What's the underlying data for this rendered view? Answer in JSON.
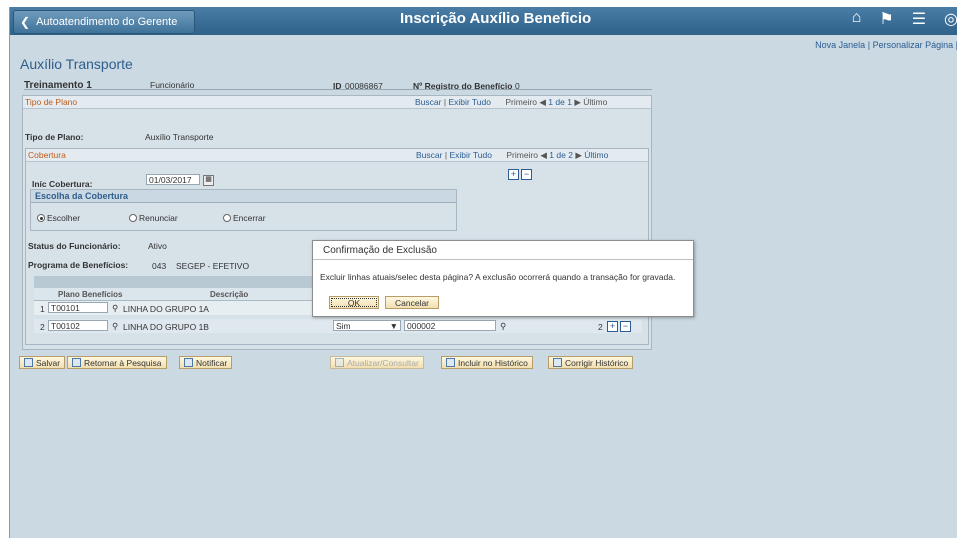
{
  "header": {
    "back_label": "Autoatendimento do Gerente",
    "title": "Inscrição Auxílio Beneficio",
    "icons": [
      "home-icon",
      "flag-icon",
      "menu-icon",
      "compass-icon"
    ]
  },
  "links": {
    "new_window": "Nova Janela",
    "personalize": "Personalizar Página",
    "sep": "|"
  },
  "page_title": "Auxílio Transporte",
  "employee": {
    "name": "Treinamento 1",
    "role": "Funcionário",
    "id_label": "ID",
    "id_value": "00086867",
    "reg_label": "Nº Registro do Benefício",
    "reg_value": "0"
  },
  "plan_section": {
    "title": "Tipo de Plano",
    "find": "Buscar",
    "view_all": "Exibir Tudo",
    "first": "Primeiro",
    "position": "1 de 1",
    "last": "Último",
    "plan_type_label": "Tipo de Plano:",
    "plan_type_value": "Auxílio Transporte"
  },
  "coverage_section": {
    "title": "Cobertura",
    "find": "Buscar",
    "view_all": "Exibir Tudo",
    "first": "Primeiro",
    "position": "1 de 2",
    "last": "Último",
    "start_label": "Iníc Cobertura:",
    "start_value": "01/03/2017",
    "choice_title": "Escolha da Cobertura",
    "choices": [
      "Escolher",
      "Renunciar",
      "Encerrar"
    ],
    "selected": "Escolher"
  },
  "status": {
    "label": "Status do Funcionário:",
    "value": "Ativo",
    "program_label": "Programa de Benefícios:",
    "program_code": "043",
    "program_name": "SEGEP - EFETIVO"
  },
  "grid": {
    "headers": [
      "Plano Benefícios",
      "Descrição"
    ],
    "rows": [
      {
        "num": "1",
        "plan": "T00101",
        "desc": "LINHA DO GRUPO 1A"
      },
      {
        "num": "2",
        "plan": "T00102",
        "desc": "LINHA DO GRUPO 1B",
        "option": "Sim",
        "code": "000002",
        "row_num": "2"
      }
    ]
  },
  "buttons": {
    "save": "Salvar",
    "return": "Retornar à Pesquisa",
    "notify": "Notificar",
    "update": "Atualizar/Consultar",
    "include": "Incluir no Histórico",
    "correct": "Corrigir Histórico"
  },
  "dialog": {
    "title": "Confirmação de Exclusão",
    "message": "Excluir linhas atuais/selec desta página? A exclusão ocorrerá quando a transação for gravada.",
    "ok": "OK",
    "cancel": "Cancelar"
  },
  "colors": {
    "topbar": "#3a6e96",
    "background": "#cbd9e2",
    "section_title": "#c25a1a",
    "link": "#2b5c93"
  }
}
